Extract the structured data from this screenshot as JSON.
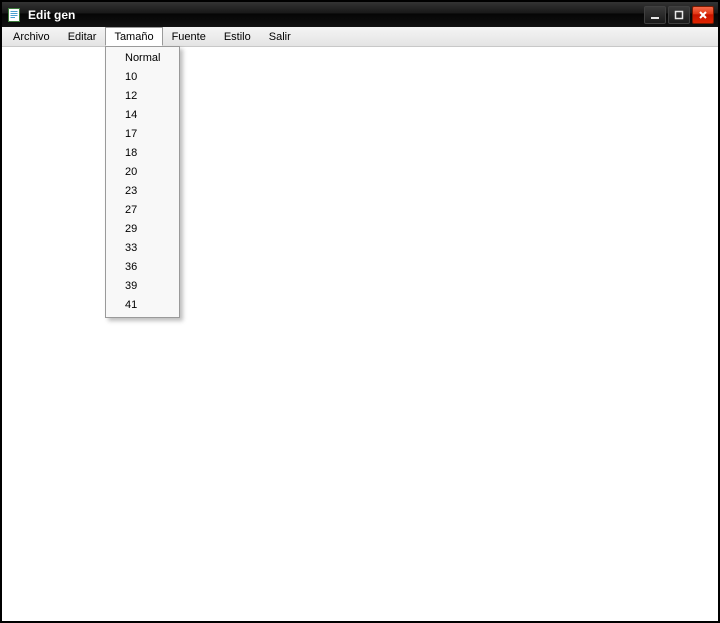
{
  "window": {
    "title": "Edit gen"
  },
  "menubar": {
    "items": [
      {
        "label": "Archivo",
        "active": false
      },
      {
        "label": "Editar",
        "active": false
      },
      {
        "label": "Tamaño",
        "active": true
      },
      {
        "label": "Fuente",
        "active": false
      },
      {
        "label": "Estilo",
        "active": false
      },
      {
        "label": "Salir",
        "active": false
      }
    ]
  },
  "dropdown": {
    "items": [
      "Normal",
      "10",
      "12",
      "14",
      "17",
      "18",
      "20",
      "23",
      "27",
      "29",
      "33",
      "36",
      "39",
      "41"
    ]
  },
  "icons": {
    "app": "document-icon",
    "minimize": "minimize-icon",
    "maximize": "maximize-icon",
    "close": "close-icon"
  }
}
